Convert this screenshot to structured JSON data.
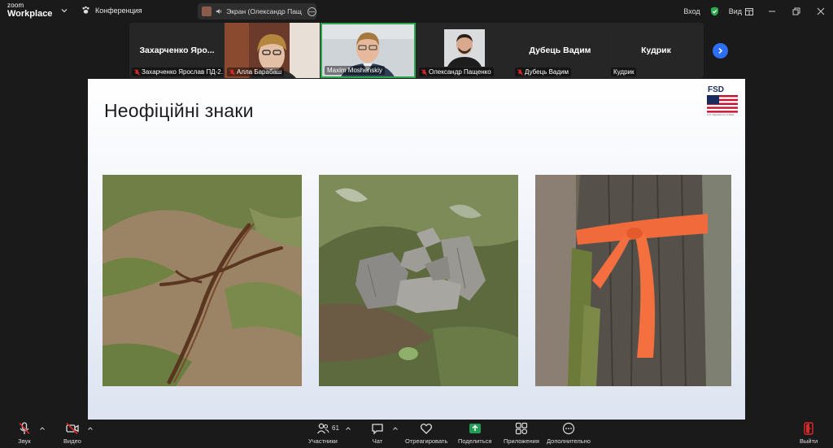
{
  "app": {
    "logo_line1": "zoom",
    "logo_line2": "Workplace",
    "conference_label": "Конференция",
    "share_label": "Экран (Олександр Пащенко)"
  },
  "top_right": {
    "login_label": "Вход",
    "view_label": "Вид",
    "shield_color": "#2ea84e"
  },
  "participants": [
    {
      "big_name": "Захарченко Яро...",
      "name": "Захарченко Ярослав ПД-2...",
      "muted": true,
      "video": false
    },
    {
      "big_name": "",
      "name": "Алла Барабаш",
      "muted": true,
      "video": true
    },
    {
      "big_name": "",
      "name": "Maxim Moshenskiy",
      "muted": false,
      "video": true,
      "active": true
    },
    {
      "big_name": "",
      "name": "Олександр Пащенко",
      "muted": true,
      "video": true
    },
    {
      "big_name": "Дубець Вадим",
      "name": "Дубець Вадим",
      "muted": true,
      "video": false
    },
    {
      "big_name": "Кудрик",
      "name": "Кудрик",
      "muted": false,
      "video": false
    }
  ],
  "slide": {
    "title": "Неофіційні знаки",
    "logo_text": "FSD",
    "logo_caption": "U.S. Department of State"
  },
  "toolbar": {
    "audio_label": "Звук",
    "video_label": "Видео",
    "participants_label": "Участники",
    "participants_count": "61",
    "chat_label": "Чат",
    "react_label": "Отреагировать",
    "share_label": "Поделиться",
    "apps_label": "Приложения",
    "more_label": "Дополнительно",
    "leave_label": "Выйти",
    "share_color": "#1f9d55",
    "leave_color": "#e02828"
  },
  "icons": [
    "zoom-logo",
    "chevron-down-icon",
    "paw-icon",
    "speaker-icon",
    "more-icon",
    "shield-check-icon",
    "grid-icon",
    "minimize-icon",
    "restore-icon",
    "close-icon",
    "mic-off-icon",
    "video-off-icon",
    "participants-icon",
    "chat-icon",
    "heart-icon",
    "share-screen-icon",
    "apps-icon",
    "more-dots-icon",
    "leave-icon",
    "chevron-right-icon"
  ]
}
